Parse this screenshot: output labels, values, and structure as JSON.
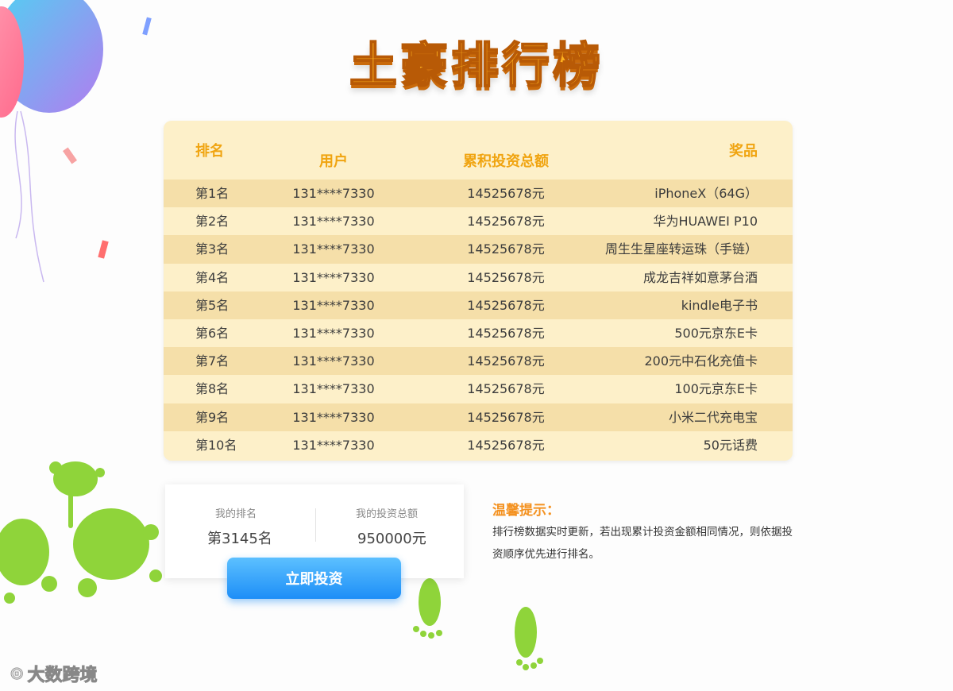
{
  "page": {
    "title": "土豪排行榜"
  },
  "table": {
    "headers": {
      "rank": "排名",
      "user": "用户",
      "total": "累积投资总额",
      "prize": "奖品"
    },
    "rows": [
      {
        "rank": "第1名",
        "user": "131****7330",
        "total": "14525678元",
        "prize": "iPhoneX（64G）"
      },
      {
        "rank": "第2名",
        "user": "131****7330",
        "total": "14525678元",
        "prize": "华为HUAWEI P10"
      },
      {
        "rank": "第3名",
        "user": "131****7330",
        "total": "14525678元",
        "prize": "周生生星座转运珠（手链）"
      },
      {
        "rank": "第4名",
        "user": "131****7330",
        "total": "14525678元",
        "prize": "成龙吉祥如意茅台酒"
      },
      {
        "rank": "第5名",
        "user": "131****7330",
        "total": "14525678元",
        "prize": "kindle电子书"
      },
      {
        "rank": "第6名",
        "user": "131****7330",
        "total": "14525678元",
        "prize": "500元京东E卡"
      },
      {
        "rank": "第7名",
        "user": "131****7330",
        "total": "14525678元",
        "prize": "200元中石化充值卡"
      },
      {
        "rank": "第8名",
        "user": "131****7330",
        "total": "14525678元",
        "prize": "100元京东E卡"
      },
      {
        "rank": "第9名",
        "user": "131****7330",
        "total": "14525678元",
        "prize": "小米二代充电宝"
      },
      {
        "rank": "第10名",
        "user": "131****7330",
        "total": "14525678元",
        "prize": "50元话费"
      }
    ]
  },
  "mine": {
    "rank_label": "我的排名",
    "rank_value": "第3145名",
    "total_label": "我的投资总额",
    "total_value": "950000元"
  },
  "invest_button": "立即投资",
  "tips": {
    "title": "温馨提示：",
    "text": "排行榜数据实时更新，若出现累计投资金额相同情况，则依据投资顺序优先进行排名。"
  },
  "watermark": "大数跨境",
  "colors": {
    "accent": "#f0a410",
    "row_dark": "#f5dfa9",
    "row_light": "#fdf0c9",
    "button": "#1d8ef7",
    "tip_title": "#f49221"
  }
}
